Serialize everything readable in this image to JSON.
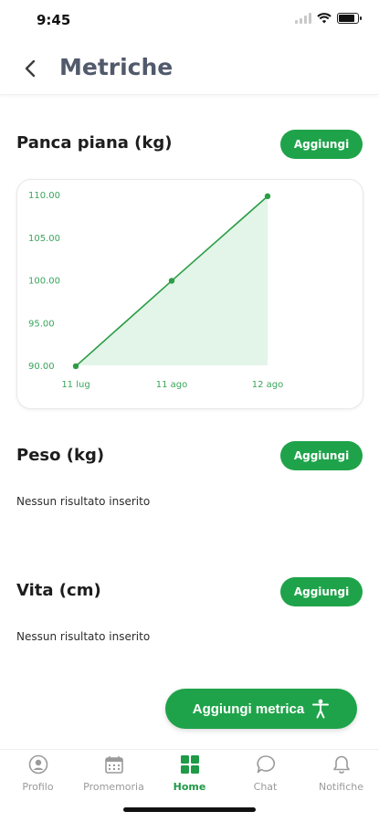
{
  "status": {
    "time": "9:45",
    "battery_level": 0.85
  },
  "header": {
    "title": "Metriche",
    "back_icon": "chevron-left-icon"
  },
  "sections": [
    {
      "title": "Panca piana (kg)",
      "add_label": "Aggiungi"
    },
    {
      "title": "Peso (kg)",
      "add_label": "Aggiungi",
      "empty_text": "Nessun risultato inserito"
    },
    {
      "title": "Vita (cm)",
      "add_label": "Aggiungi",
      "empty_text": "Nessun risultato inserito"
    }
  ],
  "chart_data": {
    "type": "area",
    "x": [
      "11 lug",
      "11 ago",
      "12 ago"
    ],
    "values": [
      89.9,
      99.9,
      109.8
    ],
    "y_ticks": [
      "90.00",
      "95.00",
      "100.00",
      "105.00",
      "110.00"
    ],
    "ylim": [
      90,
      110
    ],
    "grid": false,
    "colors": {
      "line": "#2a9d45",
      "fill": "#e3f4e8",
      "tick": "#3aa45c"
    }
  },
  "fab": {
    "label": "Aggiungi metrica",
    "icon": "person-accessibility-icon"
  },
  "tabbar": {
    "items": [
      {
        "label": "Profilo",
        "icon": "user-circle-icon",
        "active": false
      },
      {
        "label": "Promemoria",
        "icon": "calendar-icon",
        "active": false
      },
      {
        "label": "Home",
        "icon": "grid-icon",
        "active": true
      },
      {
        "label": "Chat",
        "icon": "chat-bubble-icon",
        "active": false
      },
      {
        "label": "Notifiche",
        "icon": "bell-icon",
        "active": false
      }
    ]
  },
  "colors": {
    "accent": "#1fa34a",
    "title": "#515a6b",
    "inactive": "#9a9a9a"
  }
}
